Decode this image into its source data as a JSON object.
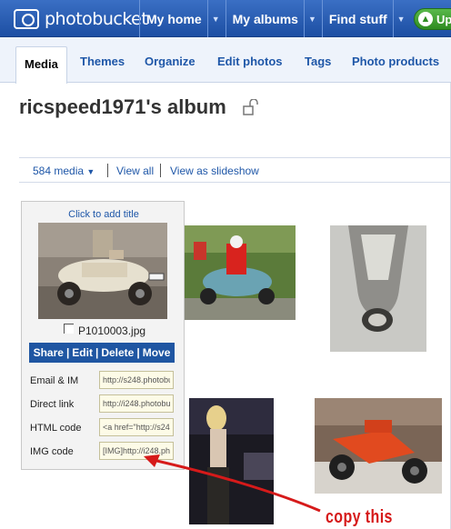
{
  "header": {
    "logo_text": "photobucket",
    "nav": [
      {
        "label": "My home"
      },
      {
        "label": "My albums"
      },
      {
        "label": "Find stuff"
      }
    ],
    "upload_label": "Upl"
  },
  "subnav": {
    "tabs": [
      "Media",
      "Themes",
      "Organize",
      "Edit photos",
      "Tags",
      "Photo products"
    ],
    "active": "Media"
  },
  "album": {
    "title": "ricspeed1971's album"
  },
  "filter": {
    "media_count": "584 media",
    "view_all": "View all",
    "slideshow": "View as slideshow"
  },
  "selected_photo": {
    "title_prompt": "Click to add title",
    "filename": "P1010003.jpg",
    "actions": [
      "Share",
      "Edit",
      "Delete",
      "Move"
    ],
    "codes": [
      {
        "label": "Email & IM",
        "value": "http://s248.photobu"
      },
      {
        "label": "Direct link",
        "value": "http://i248.photobu"
      },
      {
        "label": "HTML code",
        "value": "<a href=\"http://s24"
      },
      {
        "label": "IMG code",
        "value": "[IMG]http://i248.ph"
      }
    ]
  },
  "annotation": {
    "text": "copy this",
    "color": "#d61a1a"
  },
  "colors": {
    "nav_blue": "#1d4fa3",
    "link_blue": "#1f57a8",
    "upload_green": "#2f8c22"
  }
}
